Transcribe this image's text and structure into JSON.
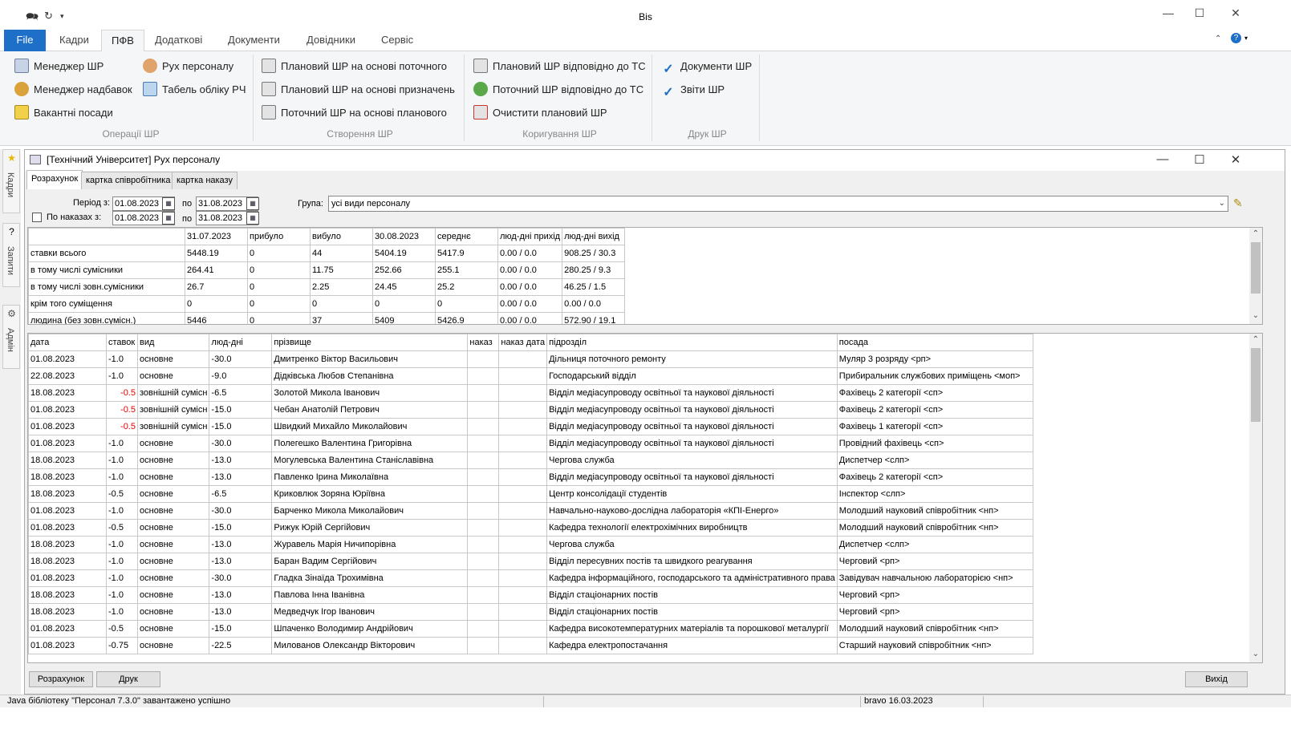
{
  "app": {
    "title": "Bis"
  },
  "ribbon_tabs": [
    "File",
    "Кадри",
    "ПФВ",
    "Додаткові",
    "Документи",
    "Довідники",
    "Сервіс"
  ],
  "ribbon": {
    "groups": [
      {
        "label": "Операції ШР",
        "buttons": [
          "Менеджер ШР",
          "Менеджер надбавок",
          "Вакантні посади",
          "Рух персоналу",
          "Табель обліку РЧ"
        ]
      },
      {
        "label": "Створення ШР",
        "buttons": [
          "Плановий ШР на основі поточного",
          "Плановий ШР на основі призначень",
          "Поточний ШР на основі планового"
        ]
      },
      {
        "label": "Коригування ШР",
        "buttons": [
          "Плановий ШР відповідно до ТС",
          "Поточний ШР відповідно до ТС",
          "Очистити плановий ШР"
        ]
      },
      {
        "label": "Друк ШР",
        "buttons": [
          "Документи ШР",
          "Звіти ШР"
        ]
      }
    ]
  },
  "side_tabs": [
    "Кадри",
    "Запити",
    "Адмін"
  ],
  "window": {
    "title": "[Технічний Університет] Рух персоналу",
    "tabs": [
      "Розрахунок",
      "картка співробітника",
      "картка наказу"
    ]
  },
  "filters": {
    "period_label": "Період з:",
    "period_from": "01.08.2023",
    "period_to_label": "по",
    "period_to": "31.08.2023",
    "orders_label": "По наказах з:",
    "orders_from": "01.08.2023",
    "orders_to_label": "по",
    "orders_to": "31.08.2023",
    "orders_checked": false,
    "group_label": "Група:",
    "group_value": "усі види персоналу"
  },
  "summary": {
    "headers": [
      "",
      "31.07.2023",
      "прибуло",
      "вибуло",
      "30.08.2023",
      "середнє",
      "люд-дні прихід",
      "люд-дні вихід"
    ],
    "rows": [
      [
        "ставки всього",
        "5448.19",
        "0",
        "44",
        "5404.19",
        "5417.9",
        "0.00 / 0.0",
        "908.25 / 30.3"
      ],
      [
        "в тому числі сумісники",
        "264.41",
        "0",
        "11.75",
        "252.66",
        "255.1",
        "0.00 / 0.0",
        "280.25 / 9.3"
      ],
      [
        "в тому числі зовн.сумісники",
        "26.7",
        "0",
        "2.25",
        "24.45",
        "25.2",
        "0.00 / 0.0",
        "46.25 / 1.5"
      ],
      [
        "крім того суміщення",
        "0",
        "0",
        "0",
        "0",
        "0",
        "0.00 / 0.0",
        "0.00 / 0.0"
      ],
      [
        "людина (без зовн.сумісн.)",
        "5446",
        "0",
        "37",
        "5409",
        "5426.9",
        "0.00 / 0.0",
        "572.90 / 19.1"
      ]
    ]
  },
  "detail": {
    "headers": [
      "дата",
      "ставок",
      "вид",
      "люд-дні",
      "прізвище",
      "наказ",
      "наказ дата",
      "підрозділ",
      "посада"
    ],
    "rows": [
      [
        "01.08.2023",
        "-1.0",
        "основне",
        "-30.0",
        "Дмитренко Віктор Васильович",
        "",
        "",
        "Дільниця поточного ремонту",
        "Муляр 3 розряду <рп>"
      ],
      [
        "22.08.2023",
        "-1.0",
        "основне",
        "-9.0",
        "Дідківська Любов Степанівна",
        "",
        "",
        "Господарський відділ",
        "Прибиральник службових приміщень <моп>"
      ],
      [
        "18.08.2023",
        "-0.5",
        "зовнішній сумісн",
        "-6.5",
        "Золотой Микола Іванович",
        "",
        "",
        "Відділ медіасупроводу освітньої та наукової діяльності",
        "Фахівець 2 категорії <сп>"
      ],
      [
        "01.08.2023",
        "-0.5",
        "зовнішній сумісн",
        "-15.0",
        "Чебан Анатолій Петрович",
        "",
        "",
        "Відділ медіасупроводу освітньої та наукової діяльності",
        "Фахівець 2 категорії <сп>"
      ],
      [
        "01.08.2023",
        "-0.5",
        "зовнішній сумісн",
        "-15.0",
        "Швидкий Михайло Миколайович",
        "",
        "",
        "Відділ медіасупроводу освітньої та наукової діяльності",
        "Фахівець 1 категорії <сп>"
      ],
      [
        "01.08.2023",
        "-1.0",
        "основне",
        "-30.0",
        "Полегешко Валентина Григорівна",
        "",
        "",
        "Відділ медіасупроводу освітньої та наукової діяльності",
        "Провідний фахівець <сп>"
      ],
      [
        "18.08.2023",
        "-1.0",
        "основне",
        "-13.0",
        "Могулевська Валентина Станіславівна",
        "",
        "",
        "Чергова служба",
        "Диспетчер <слп>"
      ],
      [
        "18.08.2023",
        "-1.0",
        "основне",
        "-13.0",
        "Павленко Ірина Миколаївна",
        "",
        "",
        "Відділ медіасупроводу освітньої та наукової діяльності",
        "Фахівець 2 категорії <сп>"
      ],
      [
        "18.08.2023",
        "-0.5",
        "основне",
        "-6.5",
        "Криковлюк Зоряна Юріївна",
        "",
        "",
        "Центр консолідації студентів",
        "Інспектор <слп>"
      ],
      [
        "01.08.2023",
        "-1.0",
        "основне",
        "-30.0",
        "Барченко Микола Миколайович",
        "",
        "",
        "Навчально-науково-дослідна лабораторія «КПІ-Енерго»",
        "Молодший науковий співробітник <нп>"
      ],
      [
        "01.08.2023",
        "-0.5",
        "основне",
        "-15.0",
        "Рижук Юрій Сергійович",
        "",
        "",
        "Кафедра технології електрохімічних виробництв",
        "Молодший науковий співробітник <нп>"
      ],
      [
        "18.08.2023",
        "-1.0",
        "основне",
        "-13.0",
        "Журавель Марія Ничипорівна",
        "",
        "",
        "Чергова служба",
        "Диспетчер <слп>"
      ],
      [
        "18.08.2023",
        "-1.0",
        "основне",
        "-13.0",
        "Баран Вадим Сергійович",
        "",
        "",
        "Відділ пересувних постів та швидкого реагування",
        "Черговий <рп>"
      ],
      [
        "01.08.2023",
        "-1.0",
        "основне",
        "-30.0",
        "Гладка Зінаїда Трохимівна",
        "",
        "",
        "Кафедра інформаційного, господарського та адміністративного права",
        "Завідувач навчальною лабораторією <нп>"
      ],
      [
        "18.08.2023",
        "-1.0",
        "основне",
        "-13.0",
        "Павлова Інна Іванівна",
        "",
        "",
        "Відділ стаціонарних постів",
        "Черговий <рп>"
      ],
      [
        "18.08.2023",
        "-1.0",
        "основне",
        "-13.0",
        "Медведчук Ігор Іванович",
        "",
        "",
        "Відділ стаціонарних постів",
        "Черговий <рп>"
      ],
      [
        "01.08.2023",
        "-0.5",
        "основне",
        "-15.0",
        "Шпаченко Володимир Андрійович",
        "",
        "",
        "Кафедра високотемпературних матеріалів та порошкової металургії",
        "Молодший науковий співробітник <нп>"
      ],
      [
        "01.08.2023",
        "-0.75",
        "основне",
        "-22.5",
        "Милованов Олександр Вікторович",
        "",
        "",
        "Кафедра електропостачання",
        "Старший науковий співробітник <нп>"
      ]
    ]
  },
  "buttons": {
    "calc": "Розрахунок",
    "print": "Друк",
    "exit": "Вихід"
  },
  "status": {
    "message": "Java бібліотеку \"Персонал 7.3.0\" завантажено успішно",
    "user": "bravo 16.03.2023"
  },
  "colors": {
    "file_tab": "#1e6fc8",
    "negative_highlight": "#ee0000"
  }
}
